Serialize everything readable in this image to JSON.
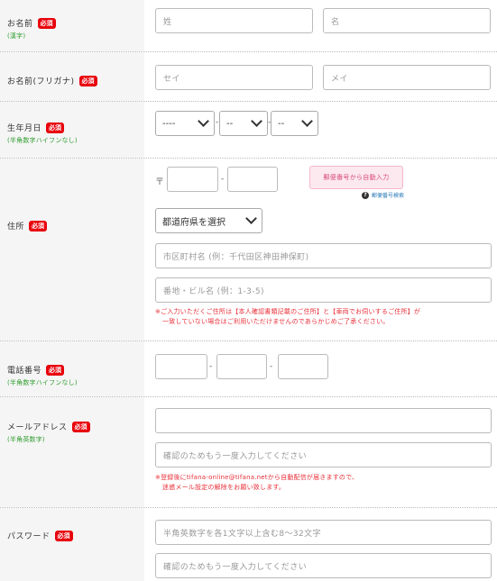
{
  "required_badge": "必須",
  "name": {
    "label": "お名前",
    "sub": "(漢字)",
    "last_placeholder": "姓",
    "first_placeholder": "名"
  },
  "kana": {
    "label": "お名前(フリガナ)",
    "last_placeholder": "セイ",
    "first_placeholder": "メイ"
  },
  "birth": {
    "label": "生年月日",
    "sub": "(半角数字ハイフンなし)",
    "year": "----",
    "month": "--",
    "day": "--",
    "sep": "-"
  },
  "address": {
    "label": "住所",
    "zip_mark": "〒",
    "zip_sep": "-",
    "zip_button": "郵便番号から自動入力",
    "zip_help": "郵便番号検索",
    "prefecture": "都道府県を選択",
    "city_placeholder": "市区町村名 (例：千代田区神田神保町)",
    "street_placeholder": "番地・ビル名 (例：1-3-5)",
    "note_line1": "※ご入力いただくご住所は【本人確認書類記載のご住所】と【車両でお伺いするご住所】が",
    "note_line2": "一致していない場合はご利用いただけませんのであらかじめご了承ください。"
  },
  "phone": {
    "label": "電話番号",
    "sub": "(半角数字ハイフンなし)",
    "sep": "-"
  },
  "email": {
    "label": "メールアドレス",
    "sub": "(半角英数字)",
    "confirm_placeholder": "確認のためもう一度入力してください",
    "note_line1": "※登録後にtifana-online@tifana.netから自動配信が届きますので、",
    "note_line2": "迷惑メール設定の解除をお願い致します。"
  },
  "password": {
    "label": "パスワード",
    "placeholder": "半角英数字を各1文字以上含む8〜32文字",
    "confirm_placeholder": "確認のためもう一度入力してください"
  }
}
